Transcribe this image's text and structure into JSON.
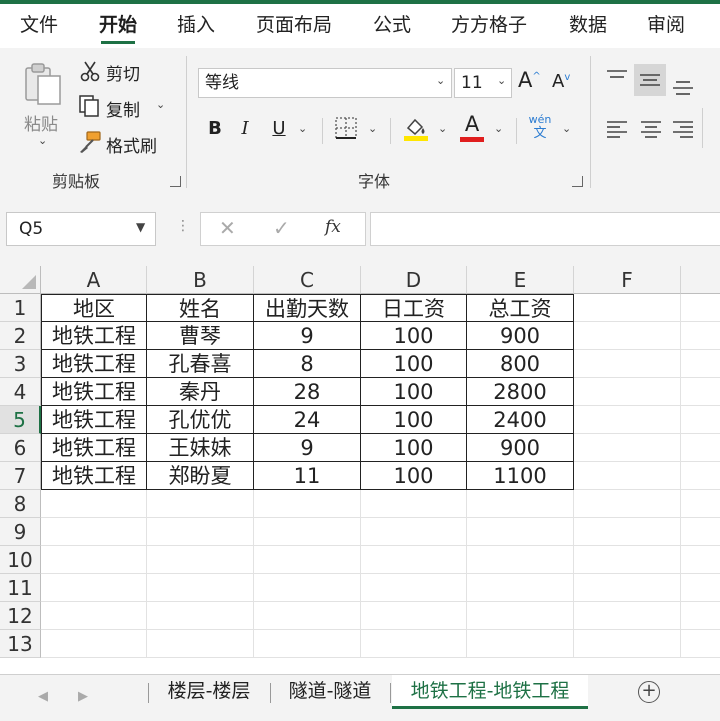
{
  "menu": {
    "tabs": [
      {
        "label": "文件"
      },
      {
        "label": "开始",
        "active": true
      },
      {
        "label": "插入"
      },
      {
        "label": "页面布局"
      },
      {
        "label": "公式"
      },
      {
        "label": "方方格子"
      },
      {
        "label": "数据"
      },
      {
        "label": "审阅"
      }
    ]
  },
  "ribbon": {
    "clipboard": {
      "paste_label": "粘贴",
      "cut_label": "剪切",
      "copy_label": "复制",
      "format_painter_label": "格式刷",
      "group_label": "剪贴板"
    },
    "font": {
      "font_name": "等线",
      "font_size": "11",
      "grow_label": "A",
      "shrink_label": "A",
      "bold": "B",
      "italic": "I",
      "underline": "U",
      "font_color_label": "A",
      "phonetic_top": "wén",
      "phonetic_bottom": "文",
      "group_label": "字体"
    }
  },
  "formula_bar": {
    "name_box": "Q5",
    "fx_label": "fx",
    "formula": ""
  },
  "grid": {
    "columns": [
      "A",
      "B",
      "C",
      "D",
      "E",
      "F"
    ],
    "row_numbers": [
      "1",
      "2",
      "3",
      "4",
      "5",
      "6",
      "7",
      "8",
      "9",
      "10",
      "11",
      "12",
      "13"
    ],
    "selected_row": "5",
    "rows": [
      [
        "地区",
        "姓名",
        "出勤天数",
        "日工资",
        "总工资"
      ],
      [
        "地铁工程",
        "曹琴",
        "9",
        "100",
        "900"
      ],
      [
        "地铁工程",
        "孔春喜",
        "8",
        "100",
        "800"
      ],
      [
        "地铁工程",
        "秦丹",
        "28",
        "100",
        "2800"
      ],
      [
        "地铁工程",
        "孔优优",
        "24",
        "100",
        "2400"
      ],
      [
        "地铁工程",
        "王妹妹",
        "9",
        "100",
        "900"
      ],
      [
        "地铁工程",
        "郑盼夏",
        "11",
        "100",
        "1100"
      ]
    ]
  },
  "sheets": {
    "tabs": [
      {
        "label": "楼层-楼层"
      },
      {
        "label": "隧道-隧道"
      },
      {
        "label": "地铁工程-地铁工程",
        "active": true
      }
    ],
    "add_label": "+"
  },
  "colors": {
    "accent": "#1e7145",
    "highlight_yellow": "#ffe600",
    "font_red": "#e01e1e"
  }
}
